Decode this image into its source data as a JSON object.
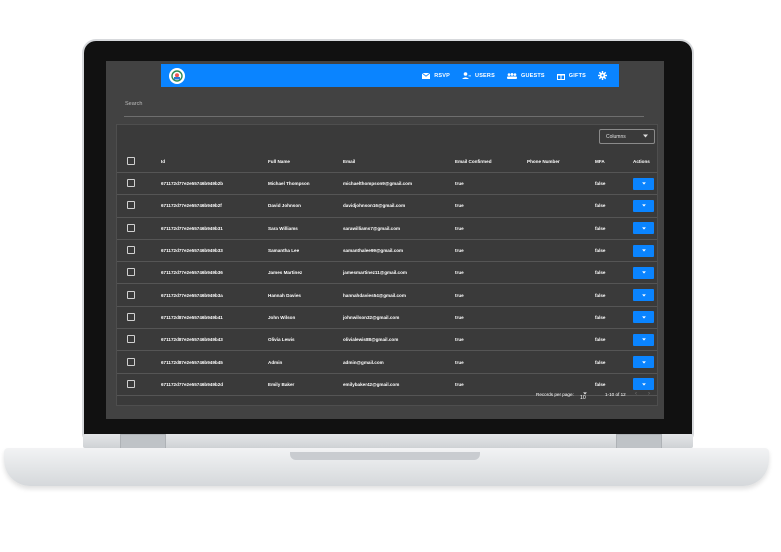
{
  "navbar": {
    "items": [
      {
        "label": "RSVP",
        "icon": "mail-icon"
      },
      {
        "label": "USERS",
        "icon": "users-icon"
      },
      {
        "label": "GUESTS",
        "icon": "guests-icon"
      },
      {
        "label": "GIFTS",
        "icon": "gift-icon"
      }
    ],
    "settings_icon": "gear-icon",
    "accent": "#0a84ff"
  },
  "search": {
    "placeholder": "Search"
  },
  "toolbar": {
    "columns_label": "Columns"
  },
  "table": {
    "headers": [
      "Id",
      "Full Name",
      "Email",
      "Email Confirmed",
      "Phone Number",
      "MFA",
      "Actions"
    ],
    "rows": [
      {
        "id": "671172d77e2e55746b949b2b",
        "name": "Michael Thompson",
        "email": "michaelthompson9@gmail.com",
        "confirmed": "true",
        "phone": "",
        "mfa": "false"
      },
      {
        "id": "671172d77e2e55746b949b2f",
        "name": "David Johnson",
        "email": "davidjohnson16@gmail.com",
        "confirmed": "true",
        "phone": "",
        "mfa": "false"
      },
      {
        "id": "671172d77e2e55746b949b31",
        "name": "Sara Williams",
        "email": "sarawilliams7@gmail.com",
        "confirmed": "true",
        "phone": "",
        "mfa": "false"
      },
      {
        "id": "671172d77e2e55746b949b33",
        "name": "Samantha Lee",
        "email": "samanthalee99@gmail.com",
        "confirmed": "true",
        "phone": "",
        "mfa": "false"
      },
      {
        "id": "671172d77e2e55746b949b36",
        "name": "James Martinez",
        "email": "jamesmartinez11@gmail.com",
        "confirmed": "true",
        "phone": "",
        "mfa": "false"
      },
      {
        "id": "671172d77e2e55746b949b3a",
        "name": "Hannah Davies",
        "email": "hannahdavies54@gmail.com",
        "confirmed": "true",
        "phone": "",
        "mfa": "false"
      },
      {
        "id": "671172d87e2e55746b949b41",
        "name": "John Wilson",
        "email": "johnwilson32@gmail.com",
        "confirmed": "true",
        "phone": "",
        "mfa": "false"
      },
      {
        "id": "671172d87e2e55746b949b43",
        "name": "Olivia Lewis",
        "email": "olivialewis88@gmail.com",
        "confirmed": "true",
        "phone": "",
        "mfa": "false"
      },
      {
        "id": "671172d87e2e55746b949b45",
        "name": "Admin",
        "email": "admin@gmail.com",
        "confirmed": "true",
        "phone": "",
        "mfa": "false"
      },
      {
        "id": "671172d77e2e55746b949b2d",
        "name": "Emily Baker",
        "email": "emilybaker42@gmail.com",
        "confirmed": "true",
        "phone": "",
        "mfa": "false"
      }
    ]
  },
  "pagination": {
    "records_label": "Records per page:",
    "per_page": "10",
    "range": "1-10 of 12"
  }
}
